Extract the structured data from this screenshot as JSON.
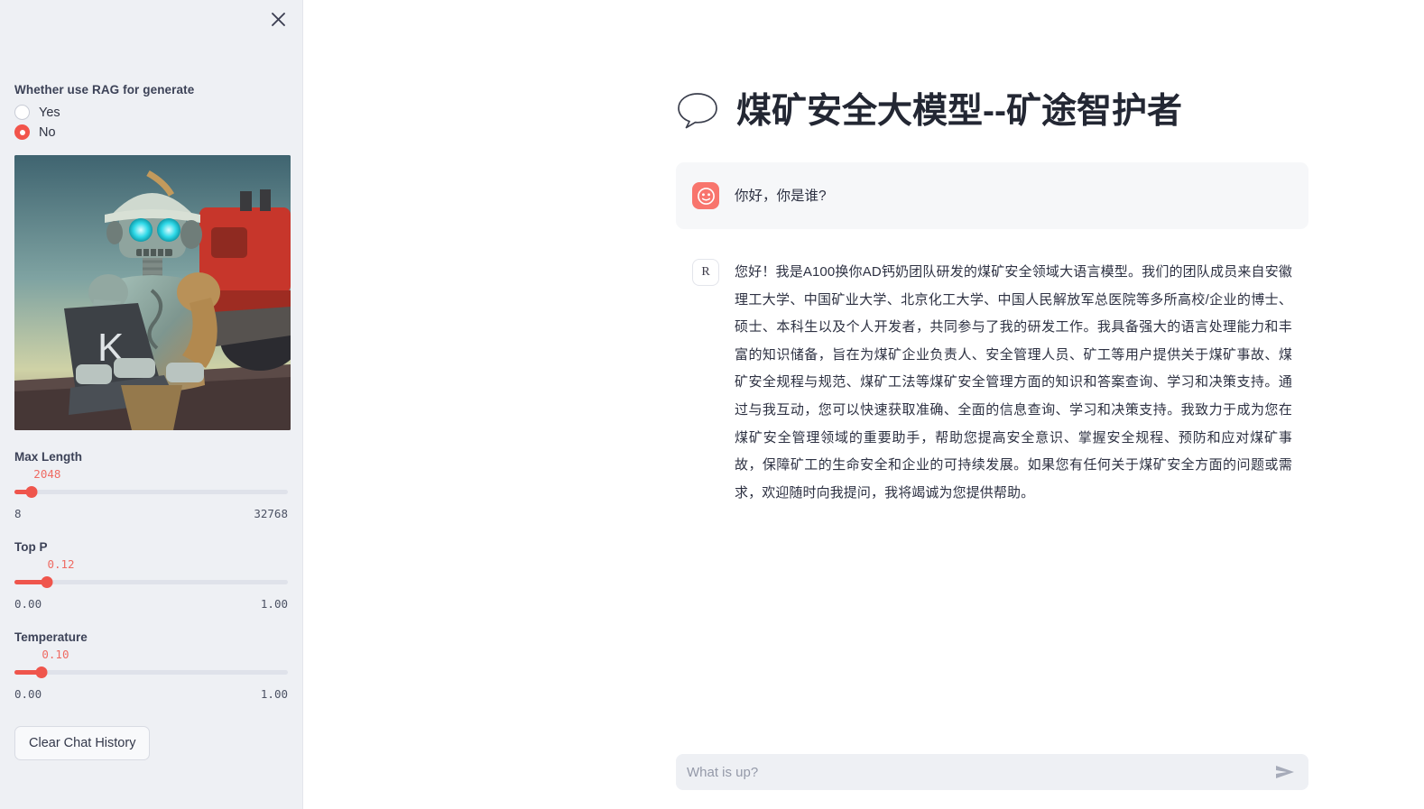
{
  "sidebar": {
    "close_icon": "close-icon",
    "rag": {
      "label": "Whether use RAG for generate",
      "options": [
        {
          "label": "Yes",
          "selected": false
        },
        {
          "label": "No",
          "selected": true
        }
      ]
    },
    "hero_image": {
      "alt": "robot-miner-with-laptop",
      "description": "Weathered humanoid robot wearing a mining hard hat holding a laptop with a K logo, red mining truck in the background"
    },
    "sliders": [
      {
        "name": "max-length",
        "title": "Max Length",
        "value": "2048",
        "percent": 6.2,
        "min": "8",
        "max": "32768"
      },
      {
        "name": "top-p",
        "title": "Top P",
        "value": "0.12",
        "percent": 12,
        "min": "0.00",
        "max": "1.00"
      },
      {
        "name": "temperature",
        "title": "Temperature",
        "value": "0.10",
        "percent": 10,
        "min": "0.00",
        "max": "1.00"
      }
    ],
    "clear_button": "Clear Chat History"
  },
  "main": {
    "title": "煤矿安全大模型--矿途智护者",
    "title_icon": "speech-bubble-icon",
    "messages": [
      {
        "role": "user",
        "avatar": "user-smiley-avatar",
        "text": "你好，你是谁?"
      },
      {
        "role": "assistant",
        "avatar": "R",
        "text": "您好！我是A100换你AD钙奶团队研发的煤矿安全领域大语言模型。我们的团队成员来自安徽理工大学、中国矿业大学、北京化工大学、中国人民解放军总医院等多所高校/企业的博士、硕士、本科生以及个人开发者，共同参与了我的研发工作。我具备强大的语言处理能力和丰富的知识储备，旨在为煤矿企业负责人、安全管理人员、矿工等用户提供关于煤矿事故、煤矿安全规程与规范、煤矿工法等煤矿安全管理方面的知识和答案查询、学习和决策支持。通过与我互动，您可以快速获取准确、全面的信息查询、学习和决策支持。我致力于成为您在煤矿安全管理领域的重要助手，帮助您提高安全意识、掌握安全规程、预防和应对煤矿事故，保障矿工的生命安全和企业的可持续发展。如果您有任何关于煤矿安全方面的问题或需求，欢迎随时向我提问，我将竭诚为您提供帮助。"
      }
    ],
    "composer": {
      "placeholder": "What is up?",
      "value": "",
      "send_icon": "send-arrow-icon"
    }
  },
  "colors": {
    "accent": "#ef554c",
    "avatar_user": "#f8756d",
    "sidebar_bg": "#eef0f4",
    "bubble_bg": "#f6f7f9",
    "text": "#2d3142"
  }
}
